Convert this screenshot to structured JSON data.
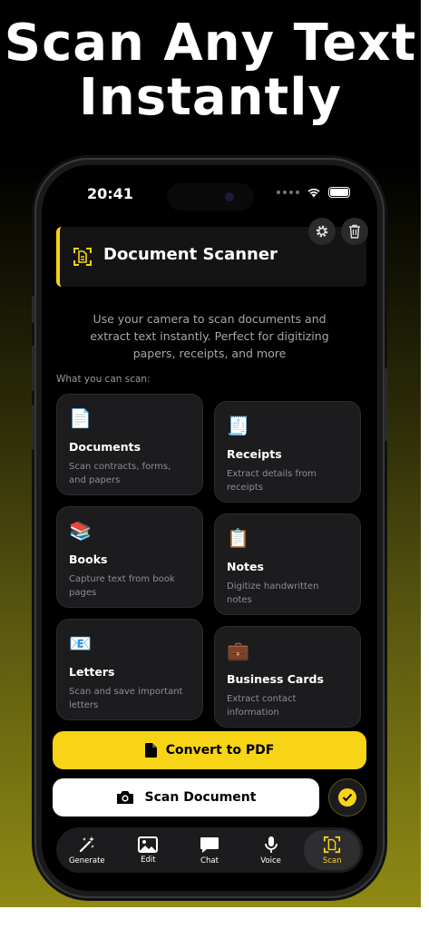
{
  "headline": {
    "line1": "Scan Any Text",
    "line2": "Instantly"
  },
  "status": {
    "time": "20:41"
  },
  "header": {
    "title": "Document Scanner"
  },
  "description": "Use your camera to scan documents and extract text instantly. Perfect for digitizing papers, receipts, and more",
  "section_label": "What you can scan:",
  "cards": [
    {
      "emoji": "📄",
      "icon": "document-icon",
      "title": "Documents",
      "desc": "Scan contracts, forms, and papers"
    },
    {
      "emoji": "🧾",
      "icon": "receipt-icon",
      "title": "Receipts",
      "desc": "Extract details from receipts"
    },
    {
      "emoji": "📚",
      "icon": "books-icon",
      "title": "Books",
      "desc": "Capture text from book pages"
    },
    {
      "emoji": "📋",
      "icon": "clipboard-icon",
      "title": "Notes",
      "desc": "Digitize handwritten notes"
    },
    {
      "emoji": "📧",
      "icon": "envelope-icon",
      "title": "Letters",
      "desc": "Scan and save important letters"
    },
    {
      "emoji": "💼",
      "icon": "briefcase-icon",
      "title": "Business Cards",
      "desc": "Extract contact information"
    }
  ],
  "buttons": {
    "pdf": "Convert to PDF",
    "scan": "Scan Document"
  },
  "tabs": [
    {
      "label": "Generate",
      "icon": "magic-wand-icon"
    },
    {
      "label": "Edit",
      "icon": "image-icon"
    },
    {
      "label": "Chat",
      "icon": "chat-bubble-icon"
    },
    {
      "label": "Voice",
      "icon": "microphone-icon"
    },
    {
      "label": "Scan",
      "icon": "scan-document-icon",
      "active": true
    }
  ],
  "colors": {
    "accent": "#f7d416",
    "background": "#000000",
    "card": "#1c1c1e"
  }
}
